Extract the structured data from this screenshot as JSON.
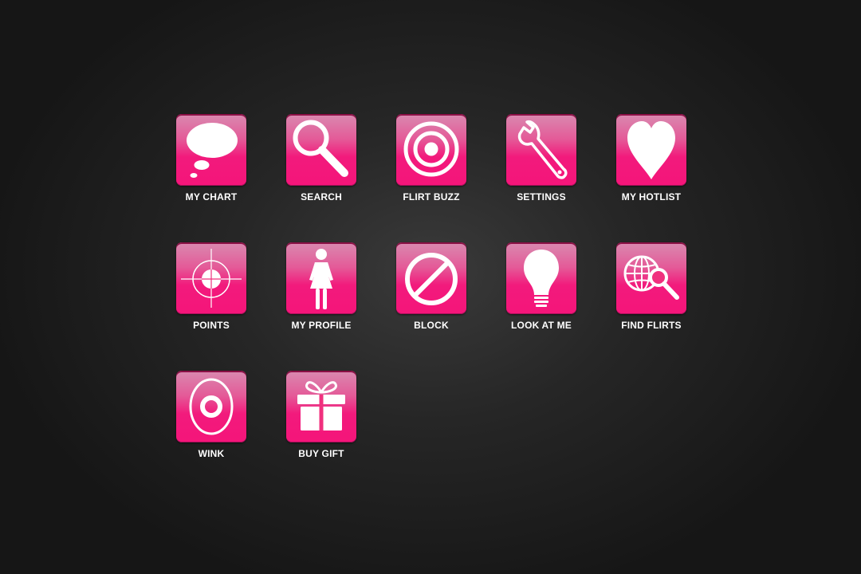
{
  "menu": {
    "items": [
      {
        "id": "my-chart",
        "label": "MY CHART",
        "icon": "thought-bubble-icon"
      },
      {
        "id": "search",
        "label": "SEARCH",
        "icon": "magnifier-icon"
      },
      {
        "id": "flirt-buzz",
        "label": "FLIRT BUZZ",
        "icon": "target-icon"
      },
      {
        "id": "settings",
        "label": "SETTINGS",
        "icon": "wrench-icon"
      },
      {
        "id": "my-hotlist",
        "label": "MY HOTLIST",
        "icon": "heart-icon"
      },
      {
        "id": "points",
        "label": "POINTS",
        "icon": "crosshair-icon"
      },
      {
        "id": "my-profile",
        "label": "MY PROFILE",
        "icon": "woman-icon"
      },
      {
        "id": "block",
        "label": "BLOCK",
        "icon": "prohibited-icon"
      },
      {
        "id": "look-at-me",
        "label": "LOOK AT ME",
        "icon": "lightbulb-icon"
      },
      {
        "id": "find-flirts",
        "label": "FIND FLIRTS",
        "icon": "globe-search-icon"
      },
      {
        "id": "wink",
        "label": "WINK",
        "icon": "eye-icon"
      },
      {
        "id": "buy-gift",
        "label": "BUY GIFT",
        "icon": "gift-icon"
      }
    ]
  },
  "colors": {
    "tile_top": "#d98ab0",
    "tile_bottom": "#f5157a",
    "icon": "#ffffff",
    "label": "#ffffff",
    "background": "#262626"
  }
}
